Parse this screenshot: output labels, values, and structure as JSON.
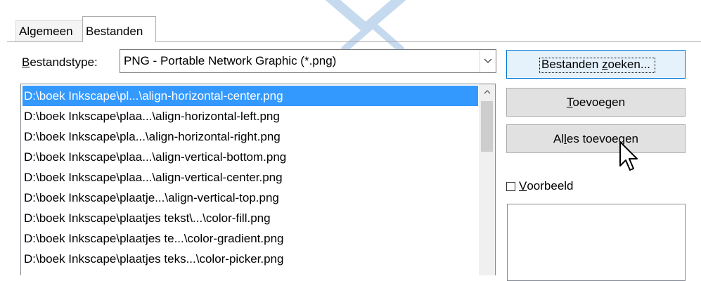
{
  "tabs": [
    {
      "label": "Algemeen"
    },
    {
      "label": "Bestanden"
    }
  ],
  "filetype": {
    "label_first": "B",
    "label_rest": "estandstype:",
    "value": "PNG - Portable Network Graphic (*.png)"
  },
  "files": [
    "D:\\boek Inkscape\\pl...\\align-horizontal-center.png",
    "D:\\boek Inkscape\\plaa...\\align-horizontal-left.png",
    "D:\\boek Inkscape\\pla...\\align-horizontal-right.png",
    "D:\\boek Inkscape\\plaa...\\align-vertical-bottom.png",
    "D:\\boek Inkscape\\plaa...\\align-vertical-center.png",
    "D:\\boek Inkscape\\plaatje...\\align-vertical-top.png",
    "D:\\boek Inkscape\\plaatjes tekst\\...\\color-fill.png",
    "D:\\boek Inkscape\\plaatjes te...\\color-gradient.png",
    "D:\\boek Inkscape\\plaatjes teks...\\color-picker.png"
  ],
  "buttons": {
    "search_a": "Bestanden ",
    "search_u": "z",
    "search_b": "oeken...",
    "add_u": "T",
    "add_b": "oevoegen",
    "addall_a": "Al",
    "addall_u": "l",
    "addall_b": "es toevoegen"
  },
  "preview": {
    "label_u": "V",
    "label_b": "oorbeeld"
  },
  "colors": {
    "selection": "#3399ff",
    "focus_border": "#0078d7"
  }
}
